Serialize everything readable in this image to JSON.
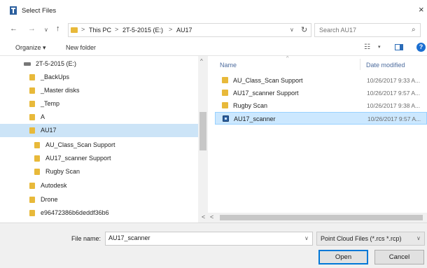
{
  "window": {
    "title": "Select Files",
    "close_glyph": "×"
  },
  "nav": {
    "back": "←",
    "forward": "→",
    "recent": "∨",
    "up": "↑",
    "breadcrumb": [
      "This PC",
      "2T-5-2015 (E:)",
      "AU17"
    ],
    "separator": ">",
    "address_dropdown": "∨",
    "refresh": "↻",
    "search_placeholder": "Search AU17",
    "search_glyph": "⌕"
  },
  "toolbar": {
    "organize": "Organize ▾",
    "new_folder": "New folder",
    "view_glyph": "☷",
    "view_dd": "▾",
    "help": "?"
  },
  "tree": {
    "items": [
      {
        "label": "2T-5-2015 (E:)",
        "kind": "drive"
      },
      {
        "label": "_BackUps",
        "kind": "folder"
      },
      {
        "label": "_Master disks",
        "kind": "folder"
      },
      {
        "label": "_Temp",
        "kind": "folder"
      },
      {
        "label": "A",
        "kind": "folder"
      },
      {
        "label": "AU17",
        "kind": "folder",
        "selected": true
      },
      {
        "label": "AU_Class_Scan Support",
        "kind": "folder"
      },
      {
        "label": "AU17_scanner Support",
        "kind": "folder"
      },
      {
        "label": "Rugby Scan",
        "kind": "folder"
      },
      {
        "label": "Autodesk",
        "kind": "folder"
      },
      {
        "label": "Drone",
        "kind": "folder"
      },
      {
        "label": "e96472386b6deddf36b6",
        "kind": "folder"
      }
    ],
    "scroll_up": "^"
  },
  "files": {
    "col_name": "Name",
    "col_sort": "^",
    "col_date": "Date modified",
    "rows": [
      {
        "name": "AU_Class_Scan Support",
        "date": "10/26/2017 9:33 A...",
        "kind": "folder"
      },
      {
        "name": "AU17_scanner Support",
        "date": "10/26/2017 9:57 A...",
        "kind": "folder"
      },
      {
        "name": "Rugby Scan",
        "date": "10/26/2017 9:38 A...",
        "kind": "folder"
      },
      {
        "name": "AU17_scanner",
        "date": "10/26/2017 9:57 A...",
        "kind": "app",
        "selected": true
      }
    ]
  },
  "hscroll": {
    "left": "<",
    "right": "<"
  },
  "bottom": {
    "filename_label": "File name:",
    "filename_value": "AU17_scanner",
    "filename_dd": "∨",
    "filetype": "Point Cloud Files (*.rcs *.rcp)",
    "filetype_dd": "∨",
    "open": "Open",
    "cancel": "Cancel"
  },
  "colors": {
    "accent": "#0078d7",
    "folder": "#e8b93a",
    "selection": "#cce8ff",
    "tree_selection": "#cce4f7"
  }
}
